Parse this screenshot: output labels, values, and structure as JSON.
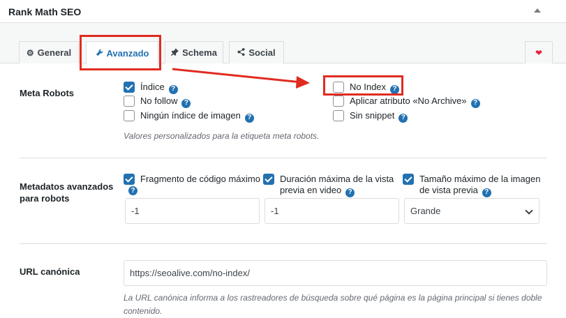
{
  "header": {
    "title": "Rank Math SEO"
  },
  "tabs": [
    {
      "label": "General",
      "icon": "gear-icon"
    },
    {
      "label": "Avanzado",
      "icon": "wrench-icon"
    },
    {
      "label": "Schema",
      "icon": "pin-icon"
    },
    {
      "label": "Social",
      "icon": "share-icon"
    }
  ],
  "meta_robots": {
    "label": "Meta Robots",
    "options": [
      {
        "label": "Índice",
        "checked": true
      },
      {
        "label": "No follow",
        "checked": false
      },
      {
        "label": "Ningún índice de imagen",
        "checked": false
      },
      {
        "label": "No Index",
        "checked": false
      },
      {
        "label": "Aplicar atributo «No Archive»",
        "checked": false
      },
      {
        "label": "Sin snippet",
        "checked": false
      }
    ],
    "description": "Valores personalizados para la etiqueta meta robots."
  },
  "advanced_meta": {
    "label_line1": "Metadatos avanzados",
    "label_line2": "para robots",
    "snippet": {
      "label_line1": "Fragmento de código máximo",
      "checked": true,
      "value": "-1"
    },
    "video": {
      "label_line1": "Duración máxima de la vista",
      "label_line2": "previa en video",
      "checked": true,
      "value": "-1"
    },
    "image": {
      "label_line1": "Tamaño máximo de la imagen",
      "label_line2": "de vista previa",
      "checked": true,
      "value": "Grande"
    }
  },
  "canonical": {
    "label": "URL canónica",
    "value": "https://seoalive.com/no-index/",
    "description_line1": "La URL canónica informa a los rastreadores de búsqueda sobre qué página es la página principal si tienes doble",
    "description_line2": "contenido."
  },
  "colors": {
    "accent": "#2271b1",
    "highlight": "#e02b20",
    "heart": "#e2263e"
  }
}
